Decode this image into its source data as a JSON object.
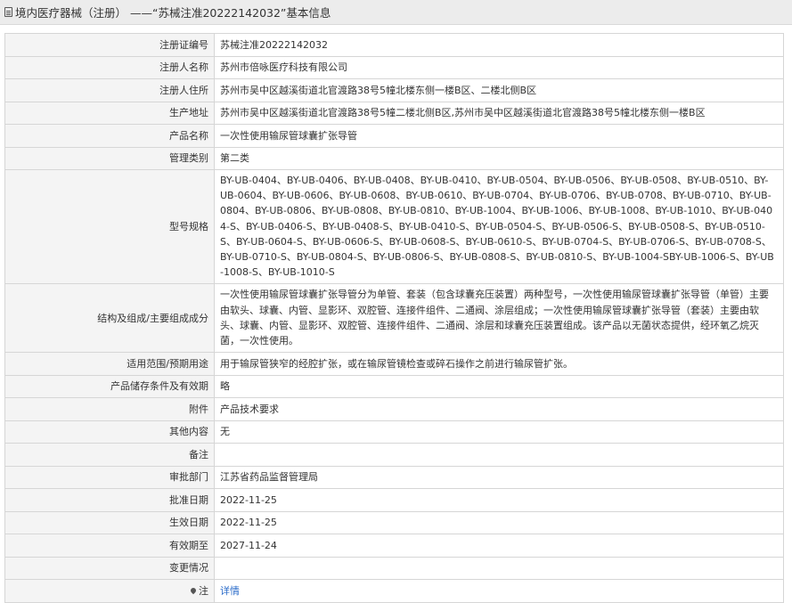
{
  "header": {
    "icon": "document-icon",
    "title": "境内医疗器械（注册） ——“苏械注准20222142032”基本信息"
  },
  "rows": [
    {
      "label": "注册证编号",
      "value": "苏械注准20222142032"
    },
    {
      "label": "注册人名称",
      "value": "苏州市倍咏医疗科技有限公司"
    },
    {
      "label": "注册人住所",
      "value": "苏州市吴中区越溪街道北官渡路38号5幢北楼东侧一楼B区、二楼北侧B区"
    },
    {
      "label": "生产地址",
      "value": "苏州市吴中区越溪街道北官渡路38号5幢二楼北侧B区,苏州市吴中区越溪街道北官渡路38号5幢北楼东侧一楼B区"
    },
    {
      "label": "产品名称",
      "value": "一次性使用输尿管球囊扩张导管"
    },
    {
      "label": "管理类别",
      "value": "第二类"
    },
    {
      "label": "型号规格",
      "value": "BY-UB-0404、BY-UB-0406、BY-UB-0408、BY-UB-0410、BY-UB-0504、BY-UB-0506、BY-UB-0508、BY-UB-0510、BY-UB-0604、BY-UB-0606、BY-UB-0608、BY-UB-0610、BY-UB-0704、BY-UB-0706、BY-UB-0708、BY-UB-0710、BY-UB-0804、BY-UB-0806、BY-UB-0808、BY-UB-0810、BY-UB-1004、BY-UB-1006、BY-UB-1008、BY-UB-1010、BY-UB-0404-S、BY-UB-0406-S、BY-UB-0408-S、BY-UB-0410-S、BY-UB-0504-S、BY-UB-0506-S、BY-UB-0508-S、BY-UB-0510-S、BY-UB-0604-S、BY-UB-0606-S、BY-UB-0608-S、BY-UB-0610-S、BY-UB-0704-S、BY-UB-0706-S、BY-UB-0708-S、BY-UB-0710-S、BY-UB-0804-S、BY-UB-0806-S、BY-UB-0808-S、BY-UB-0810-S、BY-UB-1004-SBY-UB-1006-S、BY-UB-1008-S、BY-UB-1010-S"
    },
    {
      "label": "结构及组成/主要组成成分",
      "value": "一次性使用输尿管球囊扩张导管分为单管、套装（包含球囊充压装置）两种型号，一次性使用输尿管球囊扩张导管（单管）主要由软头、球囊、内管、显影环、双腔管、连接件组件、二通阀、涂层组成；一次性使用输尿管球囊扩张导管（套装）主要由软头、球囊、内管、显影环、双腔管、连接件组件、二通阀、涂层和球囊充压装置组成。该产品以无菌状态提供，经环氧乙烷灭菌，一次性使用。"
    },
    {
      "label": "适用范围/预期用途",
      "value": "用于输尿管狭窄的经腔扩张，或在输尿管镜检查或碎石操作之前进行输尿管扩张。"
    },
    {
      "label": "产品储存条件及有效期",
      "value": "略"
    },
    {
      "label": "附件",
      "value": "产品技术要求"
    },
    {
      "label": "其他内容",
      "value": "无"
    },
    {
      "label": "备注",
      "value": ""
    },
    {
      "label": "审批部门",
      "value": "江苏省药品监督管理局"
    },
    {
      "label": "批准日期",
      "value": "2022-11-25"
    },
    {
      "label": "生效日期",
      "value": "2022-11-25"
    },
    {
      "label": "有效期至",
      "value": "2027-11-24"
    },
    {
      "label": "变更情况",
      "value": ""
    }
  ],
  "note_row": {
    "label": "注",
    "icon": "pin-icon",
    "link": "详情"
  }
}
